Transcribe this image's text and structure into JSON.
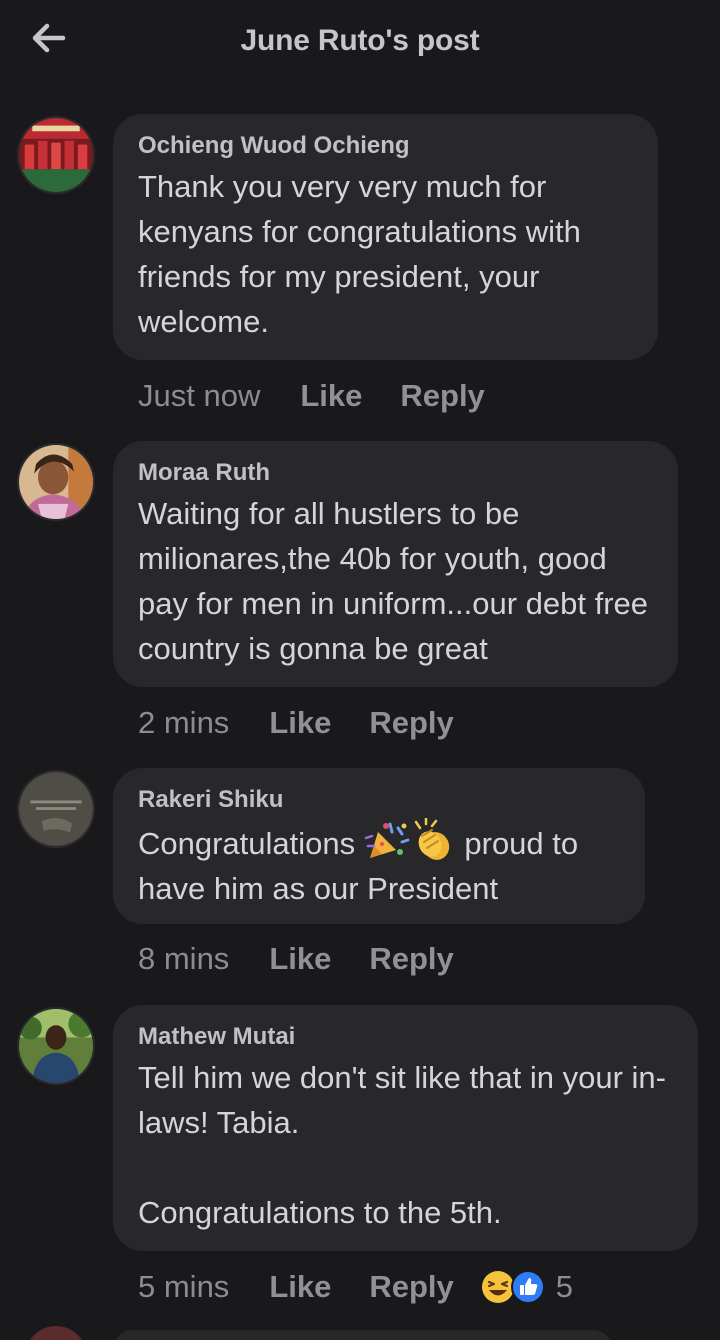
{
  "header": {
    "title": "June Ruto's post",
    "back_icon": "arrow-left-icon"
  },
  "actions": {
    "like": "Like",
    "reply": "Reply"
  },
  "comments": [
    {
      "author": "Ochieng Wuod Ochieng",
      "text": "Thank you very very much for kenyans for congratulations with friends for my president, your welcome.",
      "time": "Just now",
      "avatar": "team-photo"
    },
    {
      "author": "Moraa Ruth",
      "text": "Waiting for all hustlers to be milionares,the 40b for youth, good pay for men in uniform...our debt free country is gonna be great",
      "time": "2 mins",
      "avatar": "woman-portrait"
    },
    {
      "author": "Rakeri Shiku",
      "text_before": "Congratulations",
      "text_after": " proud to have him as our President",
      "emojis": [
        "party-popper-emoji",
        "clapping-hands-emoji"
      ],
      "time": "8 mins",
      "avatar": "quote-card"
    },
    {
      "author": "Mathew Mutai",
      "text": "Tell him we don't sit like that in your in-laws! Tabia.\n\nCongratulations to the 5th.",
      "time": "5 mins",
      "avatar": "man-outdoors",
      "reactions": {
        "icons": [
          "haha-reaction-icon",
          "like-reaction-icon"
        ],
        "count": "5"
      }
    }
  ],
  "colors": {
    "background": "#19191b",
    "bubble": "#28282b",
    "text": "#d3d5d9",
    "muted": "#8b8d92"
  }
}
